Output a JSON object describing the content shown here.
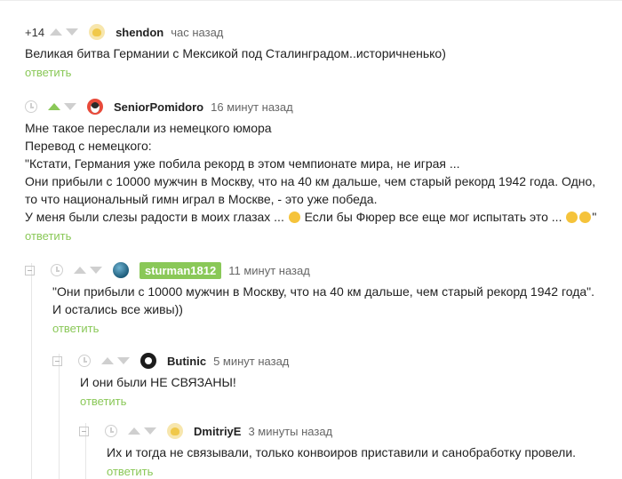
{
  "comments": [
    {
      "rating": "+14",
      "author": "shendon",
      "time": "час назад",
      "lines": [
        "Великая битва Германии с Мексикой под Сталинградом..историчненько)"
      ],
      "reply": "ответить"
    },
    {
      "author": "SeniorPomidoro",
      "time": "16 минут назад",
      "lines": [
        "Мне такое переслали из немецкого юмора",
        "Перевод с немецкого:",
        "\"Кстати, Германия уже побила рекорд в этом чемпионате мира, не играя ...",
        "Они прибыли с 10000 мужчин в Москву, что на 40 км дальше, чем старый рекорд 1942 года. Одно,",
        "то что национальный гимн играл в Москве, - это уже победа.",
        "У меня были слезы радости в моих глазах ...",
        "Если бы Фюрер все еще мог испытать это ...",
        "\""
      ],
      "reply": "ответить"
    },
    {
      "author": "sturman1812",
      "time": "11 минут назад",
      "lines": [
        "\"Они прибыли с 10000 мужчин в Москву, что на 40 км дальше, чем старый рекорд 1942 года\".",
        "И остались все живы))"
      ],
      "reply": "ответить"
    },
    {
      "author": "Butinic",
      "time": "5 минут назад",
      "lines": [
        "И они были НЕ СВЯЗАНЫ!"
      ],
      "reply": "ответить"
    },
    {
      "author": "DmitriyE",
      "time": "3 минуты назад",
      "lines": [
        "Их и тогда не связывали, только конвоиров приставили и санобработку провели."
      ],
      "reply": "ответить"
    }
  ],
  "icons": {
    "clock": "clock-icon",
    "upvote": "arrow-up-icon",
    "downvote": "arrow-down-icon",
    "collapse": "collapse-icon",
    "emoji": "smiley-emoji-icon"
  },
  "colors": {
    "accent_green": "#8ac858",
    "text": "#222222",
    "muted": "#666666",
    "icon_gray": "#cfcfcf"
  }
}
